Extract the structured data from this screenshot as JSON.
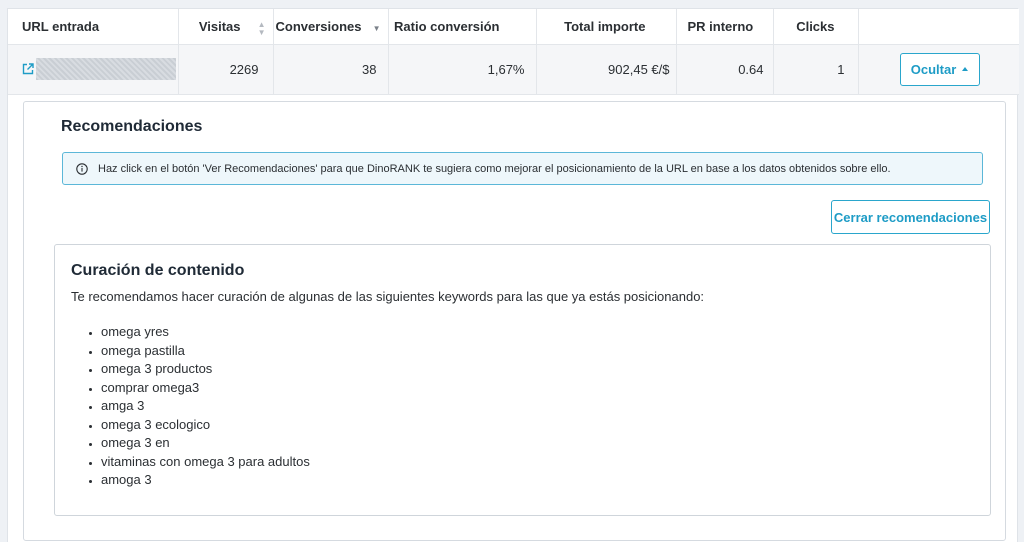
{
  "table": {
    "headers": {
      "url": "URL entrada",
      "visitas": "Visitas",
      "conversiones": "Conversiones",
      "ratio": "Ratio conversión",
      "importe": "Total importe",
      "pr": "PR interno",
      "clicks": "Clicks"
    },
    "row": {
      "visitas": "2269",
      "conversiones": "38",
      "ratio": "1,67%",
      "importe": "902,45 €/$",
      "pr": "0.64",
      "clicks": "1",
      "toggle_label": "Ocultar"
    }
  },
  "recommendations": {
    "title": "Recomendaciones",
    "info_text": "Haz click en el botón 'Ver Recomendaciones' para que DinoRANK te sugiera como mejorar el posicionamiento de la URL en base a los datos obtenidos sobre ello.",
    "close_label": "Cerrar recomendaciones",
    "card": {
      "title": "Curación de contenido",
      "description": "Te recomendamos hacer curación de algunas de las siguientes keywords para las que ya estás posicionando:",
      "keywords": [
        "omega yres",
        "omega pastilla",
        "omega 3 productos",
        "comprar omega3",
        "amga 3",
        "omega 3 ecologico",
        "omega 3 en",
        "vitaminas con omega 3 para adultos",
        "amoga 3"
      ]
    }
  },
  "colors": {
    "accent": "#1e9cc6",
    "info_border": "#5bb7d8",
    "info_bg": "#eef7fb"
  }
}
